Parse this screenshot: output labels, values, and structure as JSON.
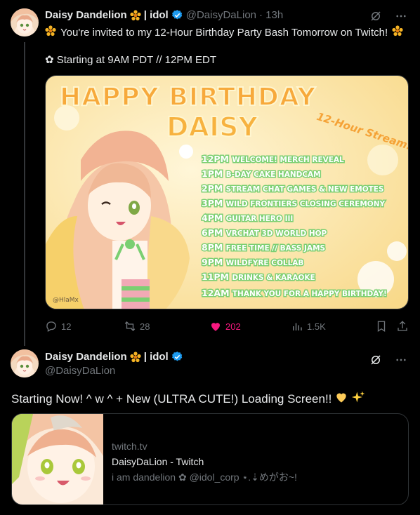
{
  "tweet1": {
    "display_name": "Daisy Dandelion",
    "name_suffix": "| idol",
    "handle": "@DaisyDaLion",
    "time": "· 13h",
    "line1": "You're invited to my 12-Hour Birthday Party Bash Tomorrow on Twitch!",
    "line2": "✿ Starting at 9AM PDT // 12PM EDT",
    "banner": {
      "title_line1": "HAPPY BIRTHDAY",
      "title_line2": "DAISY",
      "subtitle": "12-Hour Stream!",
      "artist": "@HlaMx",
      "schedule": [
        {
          "time": "12PM",
          "event": "WELCOME! MERCH REVEAL"
        },
        {
          "time": "1PM",
          "event": "B-DAY CAKE HANDCAM"
        },
        {
          "time": "2PM",
          "event": "STREAM CHAT GAMES & NEW EMOTES"
        },
        {
          "time": "3PM",
          "event": "WILD FRONTIERS CLOSING CEREMONY"
        },
        {
          "time": "4PM",
          "event": "GUITAR HERO III"
        },
        {
          "time": "6PM",
          "event": "VRCHAT 3D WORLD HOP"
        },
        {
          "time": "8PM",
          "event": "FREE TIME // BASS JAMS"
        },
        {
          "time": "9PM",
          "event": "WILDFYRE COLLAB"
        },
        {
          "time": "11PM",
          "event": "DRINKS & KARAOKE"
        },
        {
          "time": "12AM",
          "event": "THANK YOU FOR A HAPPY BIRTHDAY!"
        }
      ]
    },
    "stats": {
      "replies": "12",
      "retweets": "28",
      "likes": "202",
      "views": "1.5K"
    }
  },
  "tweet2": {
    "display_name": "Daisy Dandelion",
    "name_suffix": "| idol",
    "handle": "@DaisyDaLion",
    "text": "Starting Now! ^ w ^ + New (ULTRA CUTE!) Loading Screen!!",
    "card": {
      "domain": "twitch.tv",
      "title": "DaisyDaLion - Twitch",
      "description": "i am dandelion ✿ @idol_corp ⋆.⇣めがお~!"
    }
  },
  "colors": {
    "background": "#000000",
    "text": "#e7e9ea",
    "muted": "#71767b",
    "like": "#f91880",
    "verified": "#1d9bf0",
    "banner_bg": "#fbe7b0",
    "banner_green": "#7bcf72",
    "banner_orange": "#f5a236"
  },
  "icons": [
    "flower-icon",
    "verified-badge-icon",
    "grok-icon",
    "more-icon",
    "reply-icon",
    "retweet-icon",
    "heart-icon",
    "views-icon",
    "bookmark-icon",
    "share-icon",
    "heart-emoji",
    "sparkles-emoji"
  ]
}
